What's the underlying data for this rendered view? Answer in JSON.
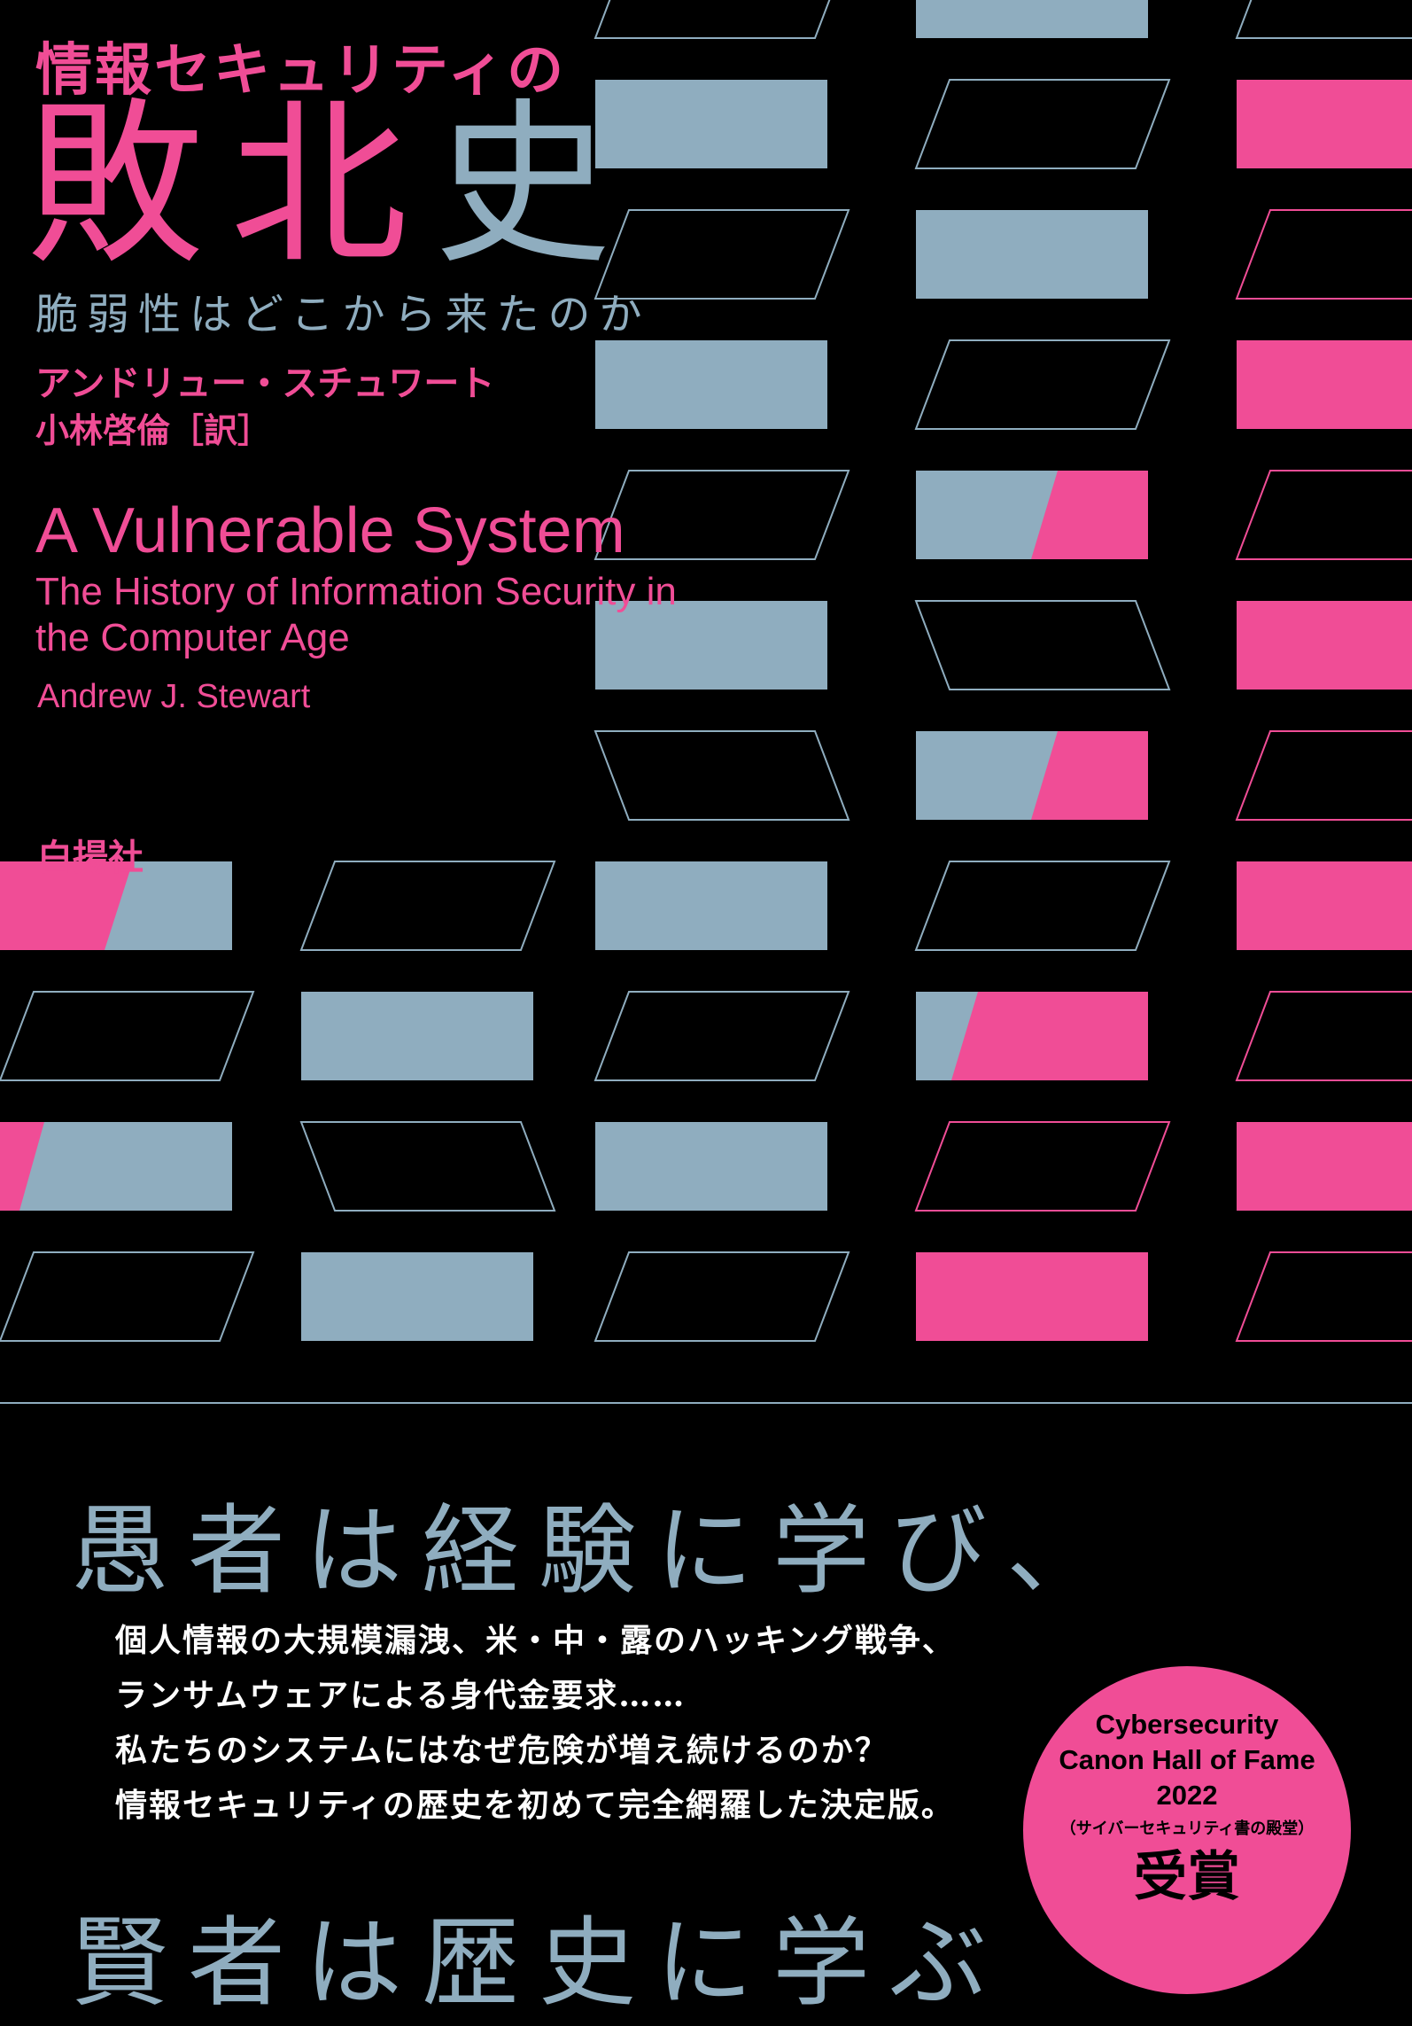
{
  "cover": {
    "series_title": "情報セキュリティの",
    "title": "敗北史",
    "subtitle": "脆弱性はどこから来たのか",
    "author_jp": "アンドリュー・スチュワート",
    "translator": "小林啓倫［訳］",
    "title_en": "A Vulnerable System",
    "subtitle_en": "The History of Information Security in the Computer Age",
    "author_en": "Andrew J. Stewart",
    "publisher": "白揚社"
  },
  "tagline": {
    "line1": "愚者は経験に学び、",
    "line2": "賢者は歴史に学ぶ"
  },
  "blurb": [
    "個人情報の大規模漏洩、米・中・露のハッキング戦争、",
    "ランサムウェアによる身代金要求……",
    "私たちのシステムにはなぜ危険が増え続けるのか？",
    "情報セキュリティの歴史を初めて完全網羅した決定版。"
  ],
  "badge": {
    "line1": "Cybersecurity",
    "line2": "Canon Hall of Fame",
    "line3": "2022",
    "line4": "（サイバーセキュリティ書の殿堂）",
    "line5": "受賞"
  },
  "colors": {
    "background": "#000000",
    "pink": "#f04d96",
    "blue": "#8fadbf"
  }
}
